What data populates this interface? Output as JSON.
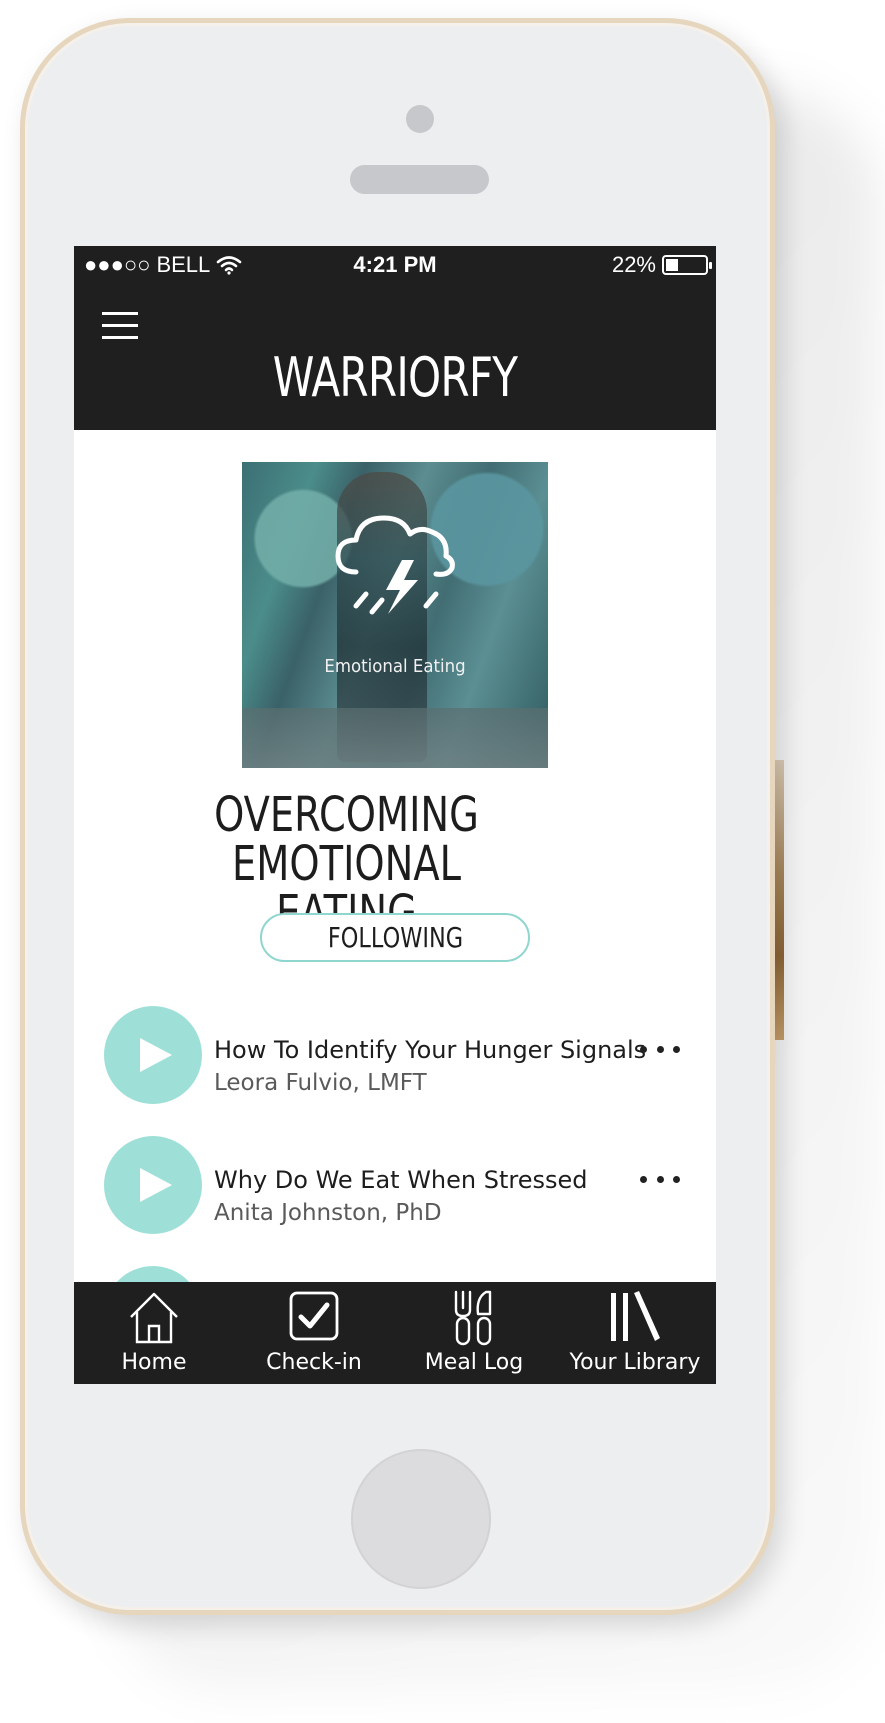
{
  "status_bar": {
    "signal": "●●●○○",
    "carrier": "BELL",
    "time": "4:21 PM",
    "battery_percent": "22%",
    "battery_level": 0.22
  },
  "header": {
    "title": "WARRIORFY",
    "menu_icon": "hamburger-menu-icon"
  },
  "program": {
    "cover_caption": "Emotional Eating",
    "cover_icon": "storm-cloud-icon",
    "title_line1": "OVERCOMING",
    "title_line2": "EMOTIONAL EATING",
    "follow_label": "FOLLOWING"
  },
  "episodes": [
    {
      "title": "How To Identify Your Hunger Signals",
      "author": "Leora Fulvio, LMFT"
    },
    {
      "title": "Why Do We Eat When Stressed",
      "author": "Anita Johnston, PhD"
    }
  ],
  "tabs": [
    {
      "label": "Home",
      "icon": "home-icon"
    },
    {
      "label": "Check-in",
      "icon": "checkbox-icon"
    },
    {
      "label": "Meal Log",
      "icon": "utensils-icon"
    },
    {
      "label": "Your Library",
      "icon": "library-icon"
    }
  ],
  "colors": {
    "bar_background": "#1f1f1f",
    "accent": "#9ee0d8",
    "follow_border": "#8fd6cf",
    "phone_frame": "#e6d6bd"
  }
}
